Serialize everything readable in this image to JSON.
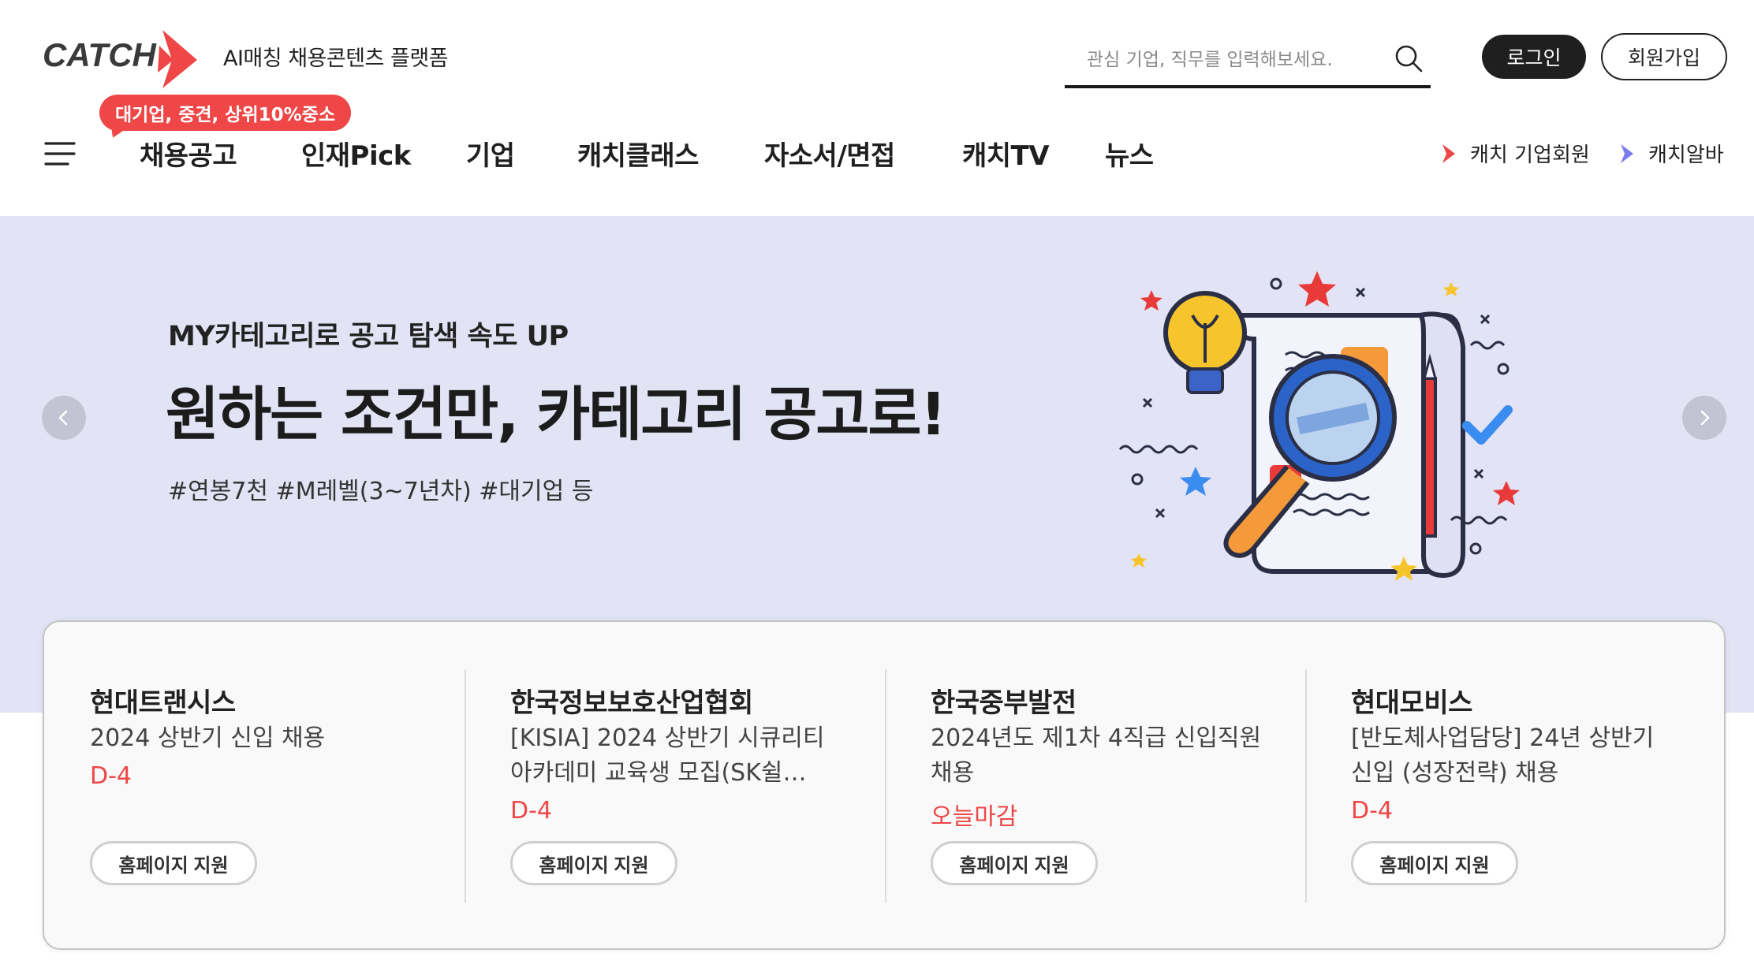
{
  "header": {
    "logo_text": "CATCH",
    "tagline": "AI매칭 채용콘텐츠 플랫폼",
    "search": {
      "placeholder": "관심 기업, 직무를 입력해보세요.",
      "value": ""
    },
    "login_label": "로그인",
    "join_label": "회원가입",
    "promo_badge": "대기업, 중견, 상위10%중소"
  },
  "nav": {
    "items": [
      {
        "label": "채용공고"
      },
      {
        "label": "인재Pick"
      },
      {
        "label": "기업"
      },
      {
        "label": "캐치클래스"
      },
      {
        "label": "자소서/면접"
      },
      {
        "label": "캐치TV"
      },
      {
        "label": "뉴스"
      }
    ],
    "side_links": [
      {
        "label": "캐치 기업회원",
        "arrow_color": "#ef4747"
      },
      {
        "label": "캐치알바",
        "arrow_color": "#7b7bf0"
      }
    ]
  },
  "hero": {
    "subtitle": "MY카테고리로 공고 탐색 속도 UP",
    "title": "원하는 조건만, 카테고리 공고로!",
    "tags": "#연봉7천 #M레벨(3~7년차) #대기업 등",
    "background": "#e2e3f4"
  },
  "job_cards": [
    {
      "company": "현대트랜시스",
      "title": "2024 상반기 신입 채용",
      "deadline": "D-4",
      "button": "홈페이지 지원"
    },
    {
      "company": "한국정보보호산업협회",
      "title": "[KISIA] 2024 상반기 시큐리티 아카데미 교육생 모집(SK쉴…",
      "deadline": "D-4",
      "button": "홈페이지 지원"
    },
    {
      "company": "한국중부발전",
      "title": "2024년도 제1차 4직급 신입직원 채용",
      "deadline": "오늘마감",
      "button": "홈페이지 지원"
    },
    {
      "company": "현대모비스",
      "title": "[반도체사업담당] 24년 상반기 신입 (성장전략) 채용",
      "deadline": "D-4",
      "button": "홈페이지 지원"
    }
  ],
  "colors": {
    "accent": "#ef4747",
    "dark": "#1f1f1f",
    "secondary_accent": "#7b7bf0"
  }
}
